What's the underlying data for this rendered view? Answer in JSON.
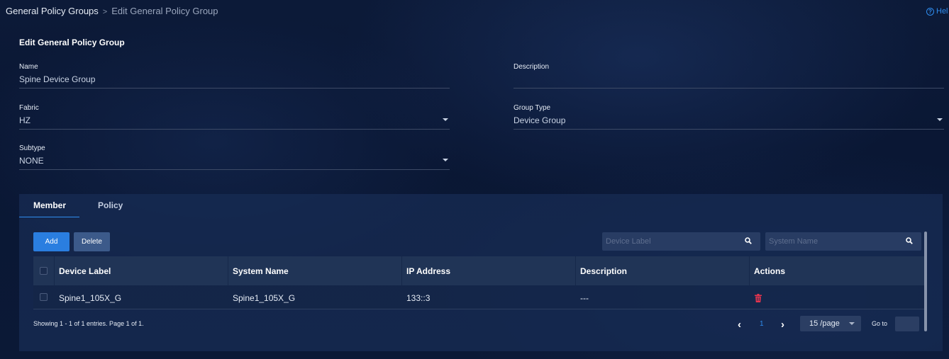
{
  "breadcrumb": {
    "parent": "General Policy Groups",
    "separator": ">",
    "current": "Edit General Policy Group"
  },
  "help": {
    "icon": "help-circle-icon",
    "label": "Hel"
  },
  "form": {
    "title": "Edit General Policy Group",
    "name": {
      "label": "Name",
      "value": "Spine Device Group"
    },
    "description": {
      "label": "Description",
      "value": ""
    },
    "fabric": {
      "label": "Fabric",
      "value": "HZ"
    },
    "group_type": {
      "label": "Group Type",
      "value": "Device Group"
    },
    "subtype": {
      "label": "Subtype",
      "value": "NONE"
    }
  },
  "tabs": [
    {
      "label": "Member",
      "active": true
    },
    {
      "label": "Policy",
      "active": false
    }
  ],
  "toolbar": {
    "add_label": "Add",
    "delete_label": "Delete",
    "search_device_label_placeholder": "Device Label",
    "search_system_name_placeholder": "System Name"
  },
  "table": {
    "columns": [
      "Device Label",
      "System Name",
      "IP Address",
      "Description",
      "Actions"
    ],
    "rows": [
      {
        "device_label": "Spine1_105X_G",
        "system_name": "Spine1_105X_G",
        "ip_address": "133::3",
        "description": "---",
        "action_icon": "trash-icon"
      }
    ]
  },
  "pagination": {
    "info": "Showing 1 - 1 of 1 entries. Page 1 of 1.",
    "current_page": "1",
    "page_size": "15 /page",
    "goto_label": "Go to",
    "goto_value": ""
  },
  "colors": {
    "accent": "#2f8df0",
    "danger": "#e8344e",
    "background": "#0b1936"
  }
}
